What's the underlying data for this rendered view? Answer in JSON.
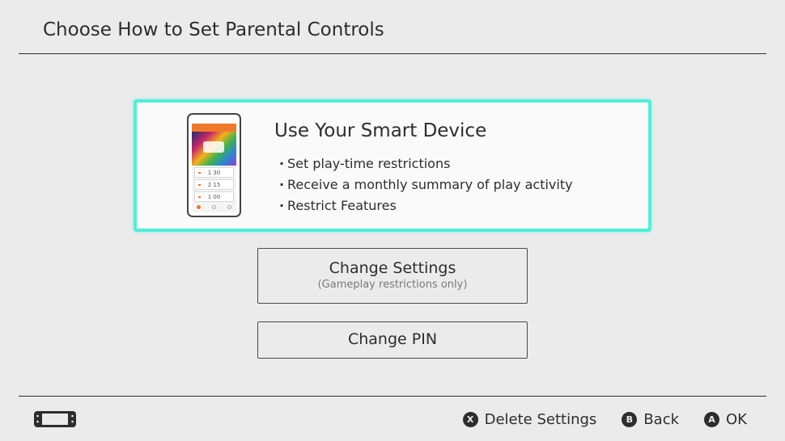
{
  "header": {
    "title": "Choose How to Set Parental Controls"
  },
  "smart_device_option": {
    "title": "Use Your Smart Device",
    "bullets": [
      "Set play-time restrictions",
      "Receive a monthly summary of play activity",
      "Restrict Features"
    ],
    "phone_rows": [
      "1  30",
      "2  15",
      "1  00"
    ],
    "accent_color": "#4df0d8"
  },
  "change_settings": {
    "label": "Change Settings",
    "sublabel": "(Gameplay restrictions only)"
  },
  "change_pin": {
    "label": "Change PIN"
  },
  "footer": {
    "console_icon": "handheld-console-icon",
    "actions": [
      {
        "button": "X",
        "label": "Delete Settings"
      },
      {
        "button": "B",
        "label": "Back"
      },
      {
        "button": "A",
        "label": "OK"
      }
    ]
  }
}
